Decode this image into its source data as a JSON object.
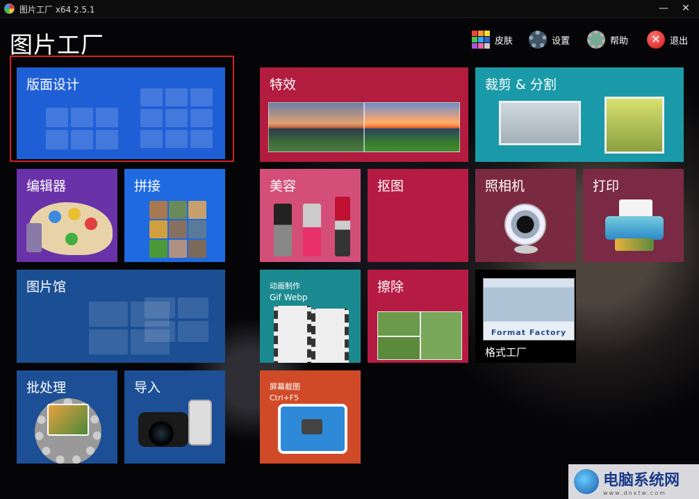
{
  "window": {
    "title": "图片工厂 x64 2.5.1",
    "minimize": "—",
    "close": "✕"
  },
  "app": {
    "title": "图片工厂"
  },
  "toolbar": {
    "skin": "皮肤",
    "settings": "设置",
    "help": "帮助",
    "exit": "退出"
  },
  "tiles": {
    "layout": "版面设计",
    "effects": "特效",
    "crop_split": "裁剪 & 分割",
    "editor": "编辑器",
    "stitch": "拼接",
    "beauty": "美容",
    "cutout": "抠图",
    "camera": "照相机",
    "print": "打印",
    "gallery": "图片馆",
    "animation_line1": "动画制作",
    "animation_line2": "Gif Webp",
    "erase": "擦除",
    "format_factory_caption": "Format Factory",
    "format_factory": "格式工厂",
    "batch": "批处理",
    "import": "导入",
    "screenshot_line1": "屏幕截图",
    "screenshot_line2": "Ctrl+F5"
  },
  "colors": {
    "layout_tile": "#1f5fd6",
    "effects_tile": "#b21c3e",
    "crop_tile": "#1a9aa8",
    "editor_tile": "#6a32a8",
    "stitch_tile": "#1f6ae0",
    "beauty_tile": "#d34f7a",
    "cutout_tile": "#b51b43",
    "camera_tile": "#7a2a40",
    "print_tile": "#7a2a44",
    "gallery_tile": "#1b4f94",
    "animation_tile": "#1a8a90",
    "erase_tile": "#b51b43",
    "batch_tile": "#1d4f96",
    "import_tile": "#1d4f96",
    "screenshot_tile": "#d14a28",
    "selection_frame": "#d62020"
  },
  "watermark": {
    "name": "电脑系统网",
    "url": "www.dnxtw.com"
  }
}
